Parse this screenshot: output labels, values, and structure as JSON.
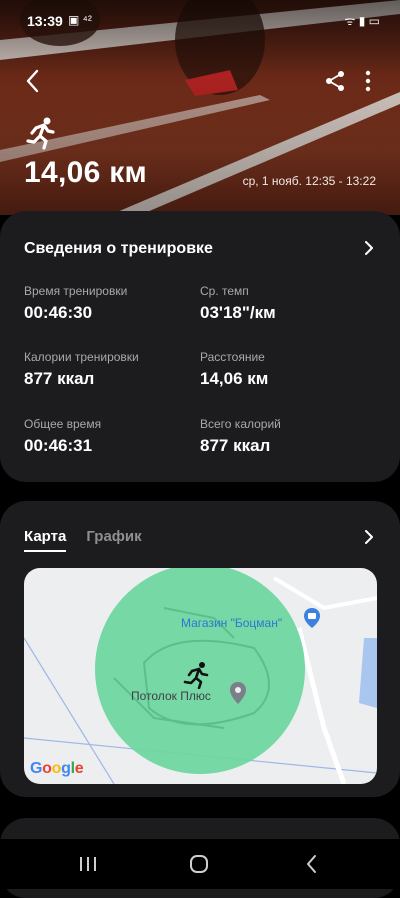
{
  "status_bar": {
    "time": "13:39",
    "left_icons": "▣ ⁴²",
    "right_icons": "ᯤ ▮ ▭"
  },
  "header": {
    "distance": "14,06 км",
    "date_range": "ср, 1 нояб. 12:35 - 13:22",
    "icons": {
      "back": "chevron-left-icon",
      "share": "share-icon",
      "more": "more-vertical-icon",
      "activity": "running-icon"
    }
  },
  "workout_details": {
    "title": "Сведения о тренировке",
    "stats": [
      {
        "label": "Время тренировки",
        "value": "00:46:30"
      },
      {
        "label": "Ср. темп",
        "value": "03'18\"/км"
      },
      {
        "label": "Калории тренировки",
        "value": "877 ккал"
      },
      {
        "label": "Расстояние",
        "value": "14,06 км"
      },
      {
        "label": "Общее время",
        "value": "00:46:31"
      },
      {
        "label": "Всего калорий",
        "value": "877 ккал"
      }
    ]
  },
  "map_card": {
    "tabs": [
      {
        "label": "Карта",
        "active": true
      },
      {
        "label": "График",
        "active": false
      }
    ],
    "map": {
      "poi_shop": "Магазин \"Боцман\"",
      "poi_place": "Потолок Плюс",
      "attribution": "Google"
    }
  },
  "colors": {
    "card": "#1c1c1e",
    "map_circle": "#6fd6a0",
    "poi_blue": "#2a78d2"
  }
}
